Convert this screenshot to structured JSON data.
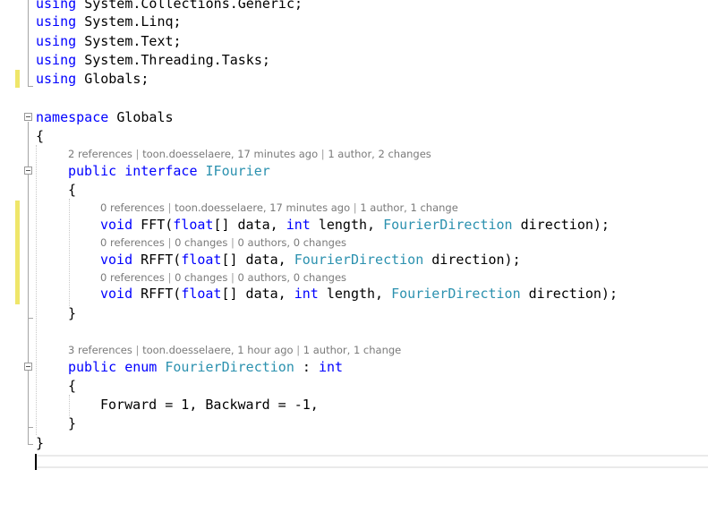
{
  "code": {
    "using_kw": "using",
    "using_lines": [
      "System.Collections.Generic;",
      "System.Linq;",
      "System.Text;",
      "System.Threading.Tasks;",
      "Globals;"
    ],
    "namespace_kw": "namespace",
    "namespace_name": "Globals",
    "open_brace": "{",
    "close_brace": "}",
    "public_kw": "public",
    "interface_kw": "interface",
    "interface_name": "IFourier",
    "void_kw": "void",
    "float_kw": "float",
    "int_kw": "int",
    "enum_kw": "enum",
    "fourier_direction": "FourierDirection",
    "fft": "FFT(",
    "rfft": "RFFT(",
    "arr_data": "[] data, ",
    "length_sep": " length, ",
    "direction_end": " direction);",
    "enum_colon": " : ",
    "enum_members": "Forward = 1, Backward = -1,"
  },
  "codelens": {
    "interface": {
      "refs": "2 references",
      "author": "toon.doesselaere, 17 minutes ago",
      "changes": "1 author, 2 changes"
    },
    "fft": {
      "refs": "0 references",
      "author": "toon.doesselaere, 17 minutes ago",
      "changes": "1 author, 1 change"
    },
    "rfft1": {
      "refs": "0 references",
      "author": "0 changes",
      "changes": "0 authors, 0 changes"
    },
    "rfft2": {
      "refs": "0 references",
      "author": "0 changes",
      "changes": "0 authors, 0 changes"
    },
    "enum": {
      "refs": "3 references",
      "author": "toon.doesselaere, 1 hour ago",
      "changes": "1 author, 1 change"
    },
    "separator": " | "
  },
  "colors": {
    "keyword": "#0000ff",
    "type": "#2b91af",
    "codelens": "#7a7a7a",
    "change_bar": "#efe66a"
  }
}
